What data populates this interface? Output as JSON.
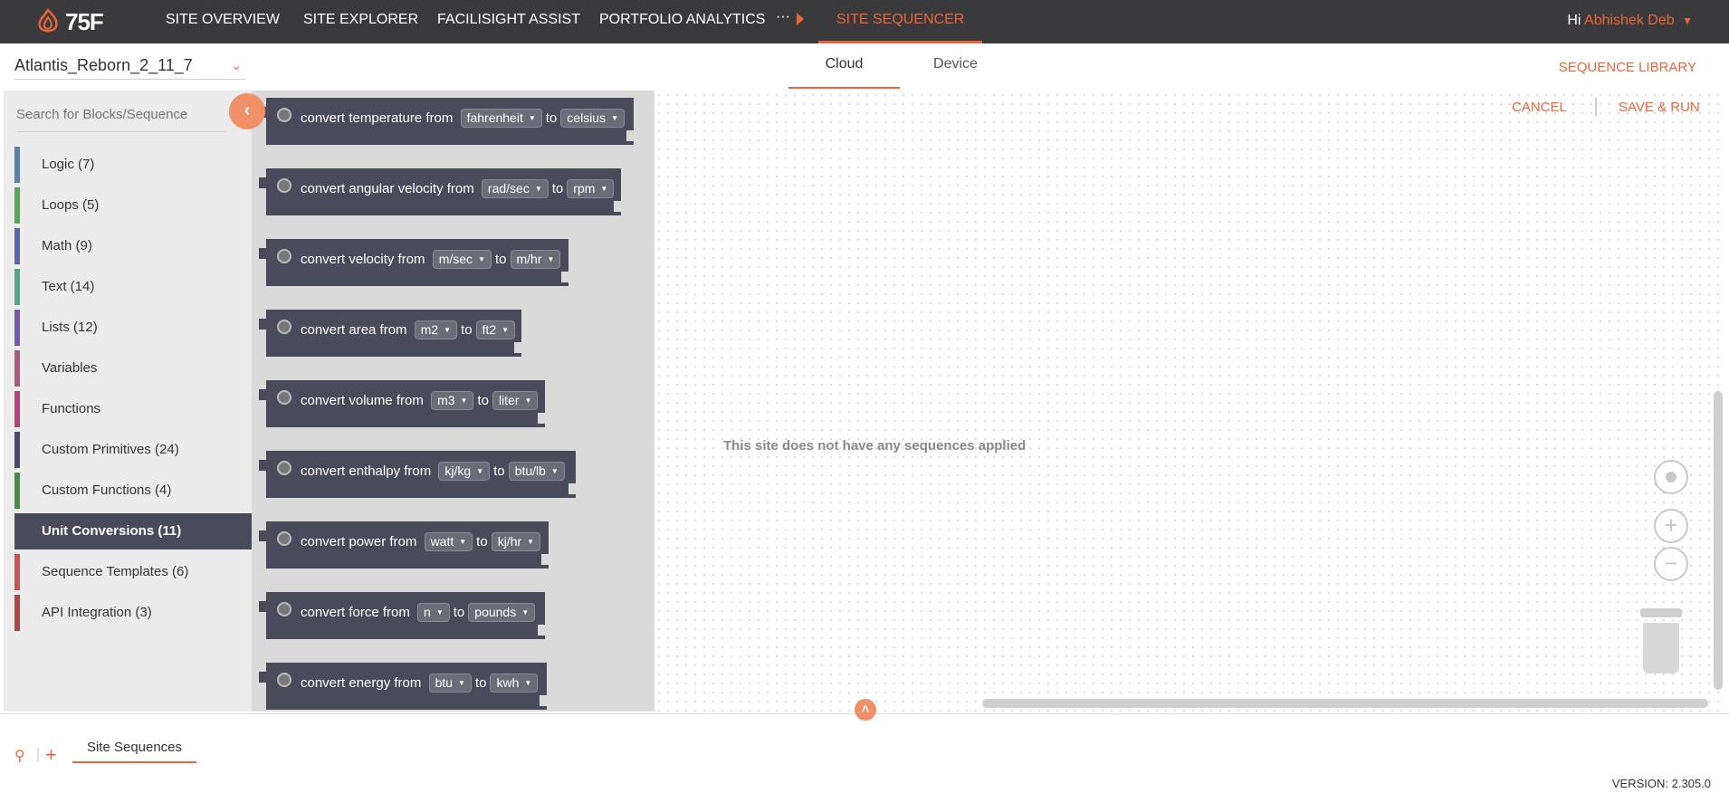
{
  "brand": {
    "logo_text": "75F",
    "accent": "#e8673a"
  },
  "nav": {
    "items": [
      "SITE OVERVIEW",
      "SITE EXPLORER",
      "FACILISIGHT ASSIST",
      "PORTFOLIO ANALYTICS"
    ],
    "more": "···",
    "active": "SITE SEQUENCER",
    "greeting": "Hi",
    "user": "Abhishek Deb"
  },
  "subheader": {
    "site": "Atlantis_Reborn_2_11_7",
    "tabs": [
      "Cloud",
      "Device"
    ],
    "active_tab": "Cloud",
    "sequence_library": "SEQUENCE LIBRARY"
  },
  "toolbox": {
    "search_placeholder": "Search for Blocks/Sequence",
    "categories": [
      {
        "label": "Logic (7)",
        "color": "#5b80a5"
      },
      {
        "label": "Loops (5)",
        "color": "#5ba55b"
      },
      {
        "label": "Math (9)",
        "color": "#5b67a5"
      },
      {
        "label": "Text (14)",
        "color": "#5ba58c"
      },
      {
        "label": "Lists (12)",
        "color": "#745ba5"
      },
      {
        "label": "Variables",
        "color": "#a55b80"
      },
      {
        "label": "Functions",
        "color": "#995ba5"
      },
      {
        "label": "Custom Primitives (24)",
        "color": "#4a4b6a"
      },
      {
        "label": "Custom Functions (4)",
        "color": "#4a8a4a"
      },
      {
        "label": "Unit Conversions (11)",
        "color": "#4a4b5a",
        "active": true
      },
      {
        "label": "Sequence Templates (6)",
        "color": "#c05858"
      },
      {
        "label": "API Integration (3)",
        "color": "#a54a4a"
      }
    ]
  },
  "blocks": [
    {
      "text": "convert temperature from",
      "from": "fahrenheit",
      "to_label": "to",
      "to": "celsius"
    },
    {
      "text": "convert angular velocity from",
      "from": "rad/sec",
      "to_label": "to",
      "to": "rpm"
    },
    {
      "text": "convert velocity from",
      "from": "m/sec",
      "to_label": "to",
      "to": "m/hr"
    },
    {
      "text": "convert area from",
      "from": "m2",
      "to_label": "to",
      "to": "ft2"
    },
    {
      "text": "convert volume from",
      "from": "m3",
      "to_label": "to",
      "to": "liter"
    },
    {
      "text": "convert enthalpy from",
      "from": "kj/kg",
      "to_label": "to",
      "to": "btu/lb"
    },
    {
      "text": "convert power from",
      "from": "watt",
      "to_label": "to",
      "to": "kj/hr"
    },
    {
      "text": "convert force from",
      "from": "n",
      "to_label": "to",
      "to": "pounds"
    },
    {
      "text": "convert energy from",
      "from": "btu",
      "to_label": "to",
      "to": "kwh"
    }
  ],
  "workspace": {
    "cancel": "CANCEL",
    "save_run": "SAVE & RUN",
    "empty_message": "This site does not have any sequences applied"
  },
  "bottom": {
    "tab": "Site Sequences",
    "version": "VERSION: 2.305.0"
  }
}
